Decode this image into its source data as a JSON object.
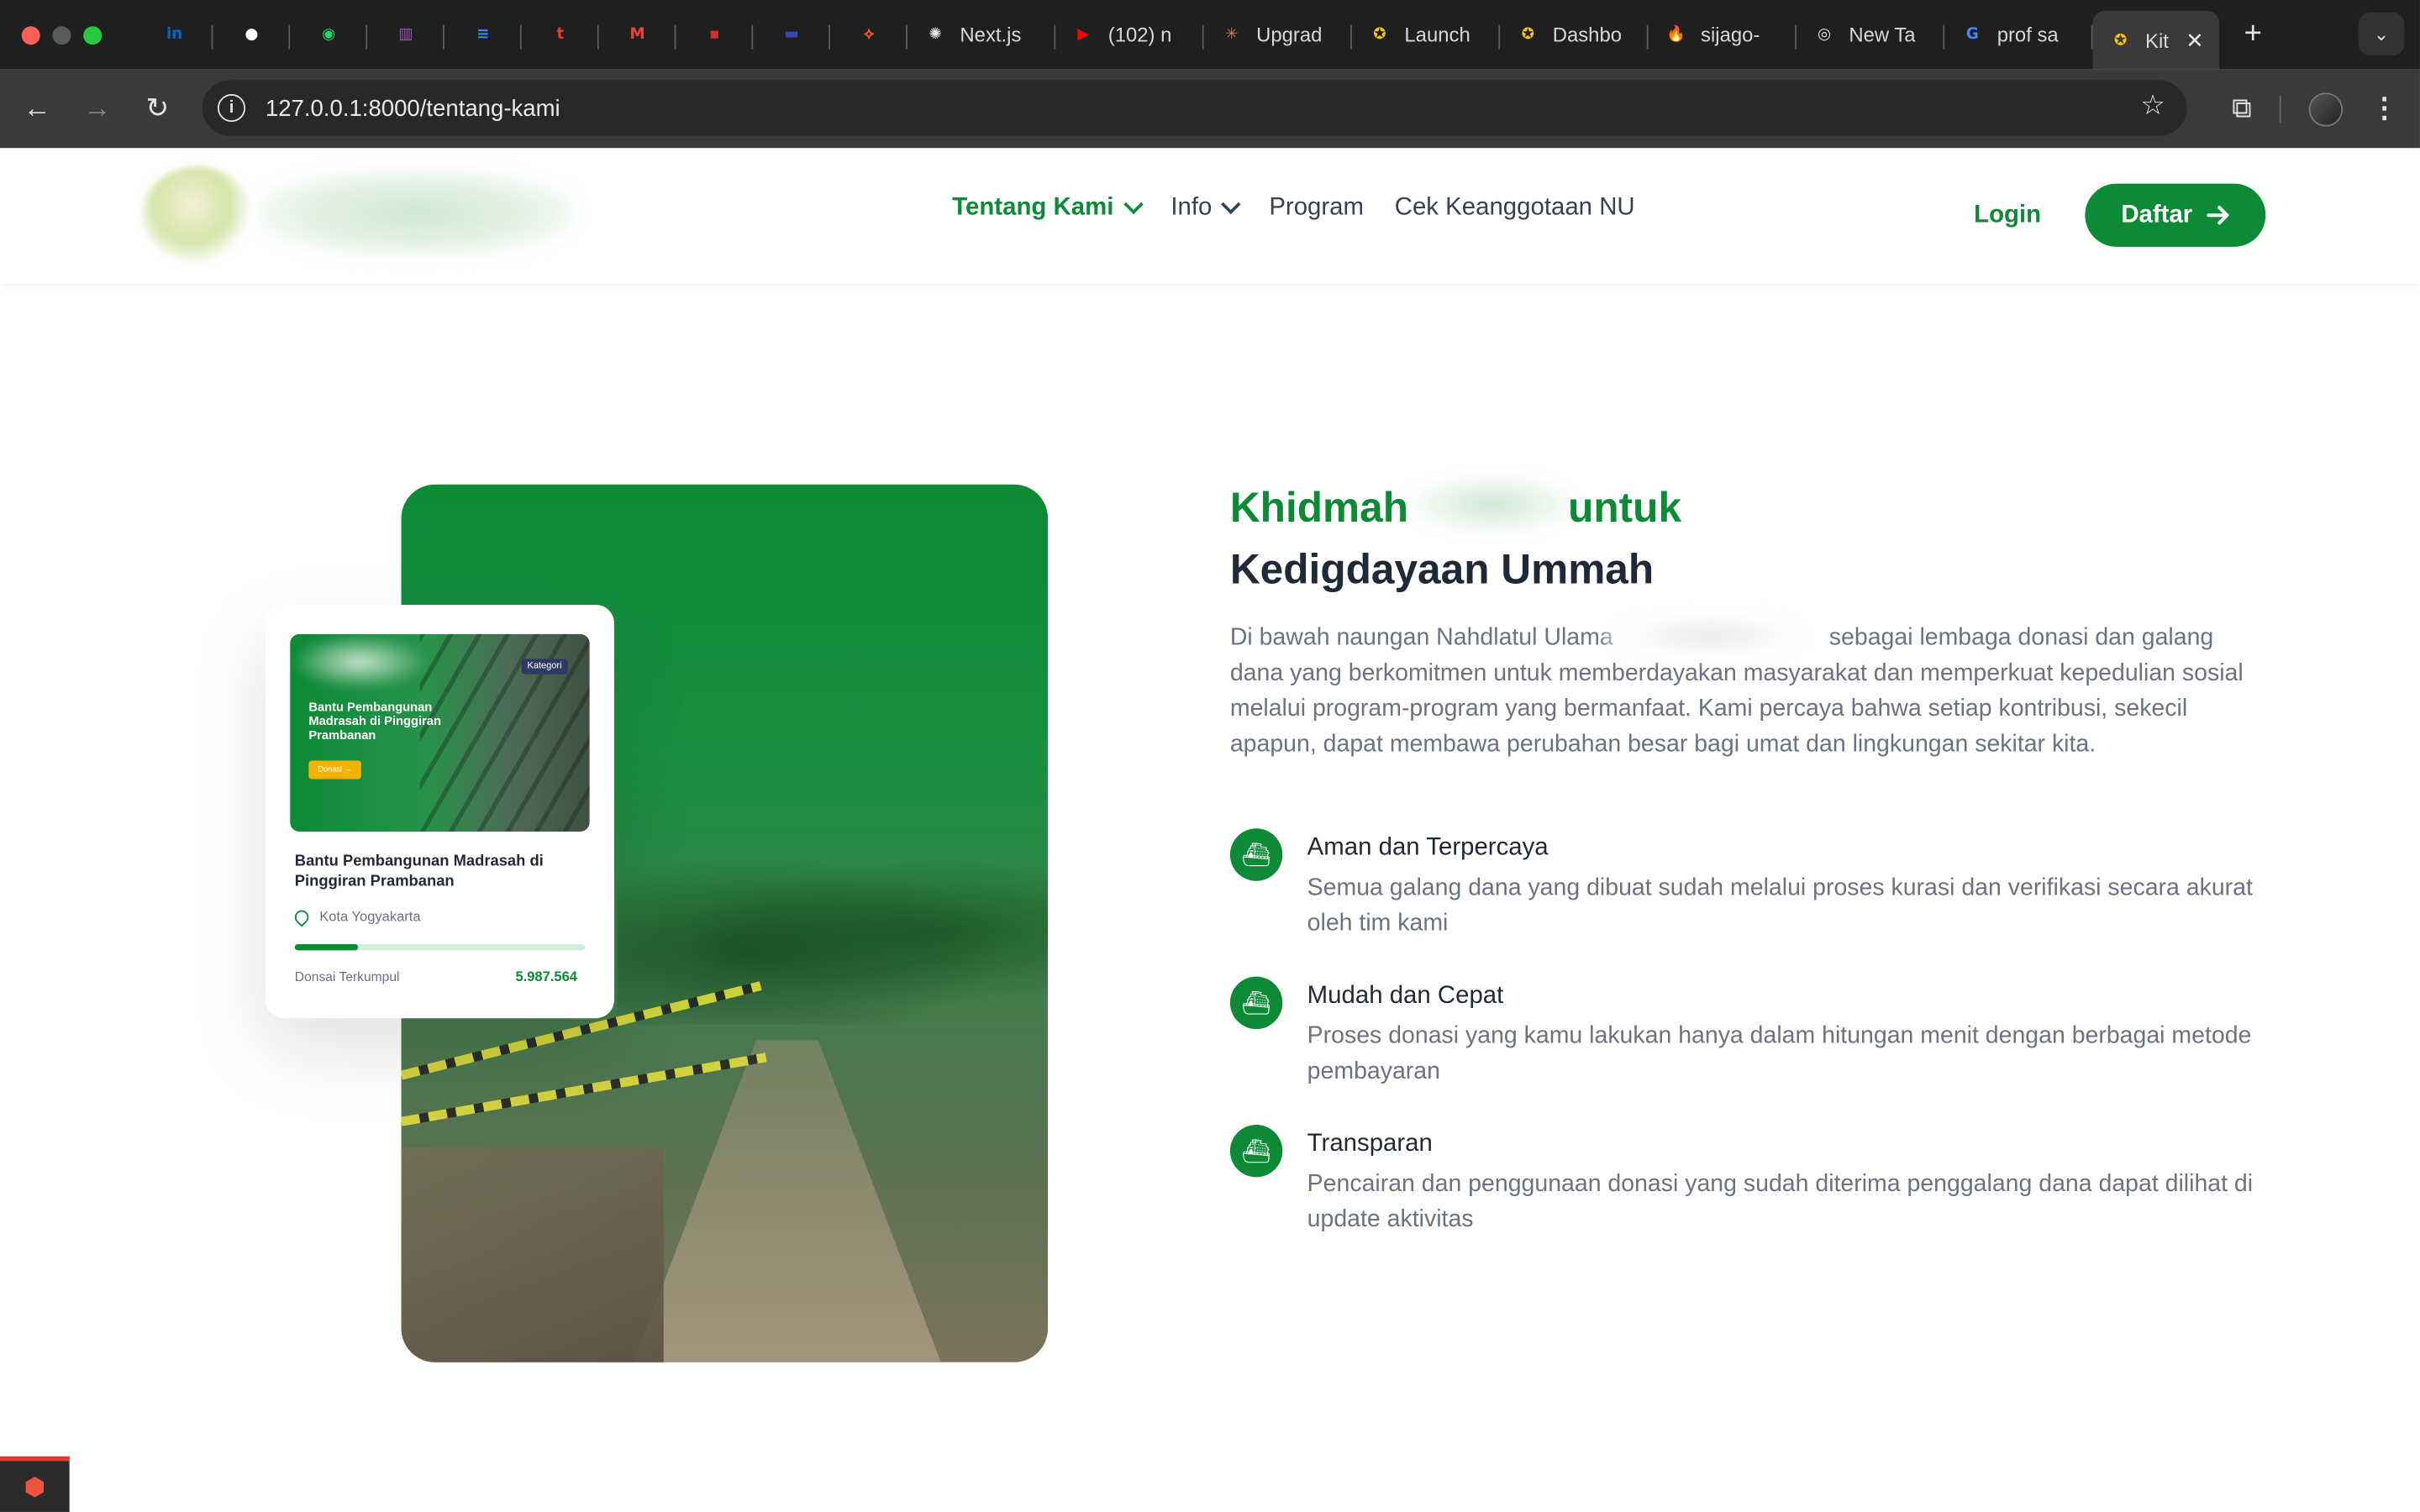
{
  "browser": {
    "tabs": [
      {
        "icon": "linkedin-icon",
        "glyph": "in",
        "color": "#0a66c2",
        "title": ""
      },
      {
        "icon": "github-icon",
        "glyph": "●",
        "color": "#ffffff",
        "title": ""
      },
      {
        "icon": "whatsapp-icon",
        "glyph": "◉",
        "color": "#25d366",
        "title": ""
      },
      {
        "icon": "trello-icon",
        "glyph": "▥",
        "color": "#9b59b6",
        "title": ""
      },
      {
        "icon": "docs-icon",
        "glyph": "≡",
        "color": "#4285f4",
        "title": ""
      },
      {
        "icon": "t-icon",
        "glyph": "t",
        "color": "#e53935",
        "title": ""
      },
      {
        "icon": "gmail-icon",
        "glyph": "M",
        "color": "#ea4335",
        "title": ""
      },
      {
        "icon": "toyota-icon",
        "glyph": "▪",
        "color": "#d32f2f",
        "title": ""
      },
      {
        "icon": "site-icon",
        "glyph": "▬",
        "color": "#3949ab",
        "title": ""
      },
      {
        "icon": "laravel-icon",
        "glyph": "⟡",
        "color": "#ff5722",
        "title": ""
      },
      {
        "icon": "openai-icon",
        "glyph": "✺",
        "color": "#e3e3e3",
        "title": "Next.js"
      },
      {
        "icon": "youtube-icon",
        "glyph": "▶",
        "color": "#ff0000",
        "title": "(102) n"
      },
      {
        "icon": "claude-icon",
        "glyph": "✳",
        "color": "#d97757",
        "title": "Upgrad"
      },
      {
        "icon": "nu-icon",
        "glyph": "✪",
        "color": "#f9c80e",
        "title": "Launch"
      },
      {
        "icon": "nu-icon",
        "glyph": "✪",
        "color": "#f9c80e",
        "title": "Dashbo"
      },
      {
        "icon": "firebase-icon",
        "glyph": "🔥",
        "color": "#ff9800",
        "title": "sijago-"
      },
      {
        "icon": "chrome-icon",
        "glyph": "◎",
        "color": "#e3e3e3",
        "title": "New Ta"
      },
      {
        "icon": "google-icon",
        "glyph": "G",
        "color": "#4285f4",
        "title": "prof sa"
      }
    ],
    "active_tab": {
      "icon": "nu-icon",
      "glyph": "✪",
      "color": "#f9c80e",
      "title": "Kit"
    },
    "url": "127.0.0.1:8000/tentang-kami"
  },
  "site": {
    "nav": [
      {
        "label": "Tentang Kami",
        "dropdown": true,
        "active": true
      },
      {
        "label": "Info",
        "dropdown": true,
        "active": false
      },
      {
        "label": "Program",
        "dropdown": false,
        "active": false
      },
      {
        "label": "Cek Keanggotaan NU",
        "dropdown": false,
        "active": false
      }
    ],
    "login": "Login",
    "register": "Daftar",
    "accent": "#0c8a36"
  },
  "card": {
    "badge": "Kategori",
    "image_title": "Bantu Pembangunan Madrasah di Pinggiran Prambanan",
    "image_button": "Donasi →",
    "title": "Bantu Pembangunan Madrasah di Pinggiran Prambanan",
    "location": "Kota Yogyakarta",
    "progress": 0.22,
    "collected_label": "Donsai Terkumpul",
    "collected_value": "5.987.564"
  },
  "about": {
    "heading_a": "Khidmah",
    "heading_b": "untuk",
    "heading_line2": "Kedigdayaan Ummah",
    "description_a": "Di bawah naungan Nahdlatul Ulama",
    "description_b": "sebagai lembaga donasi dan galang dana yang berkomitmen untuk memberdayakan masyarakat dan memperkuat kepedulian sosial melalui program-program yang bermanfaat. Kami percaya bahwa setiap kontribusi, sekecil apapun, dapat membawa perubahan besar bagi umat dan lingkungan sekitar kita.",
    "features": [
      {
        "title": "Aman dan Terpercaya",
        "text": "Semua galang dana yang dibuat sudah melalui proses kurasi dan verifikasi secara akurat oleh tim kami"
      },
      {
        "title": "Mudah dan Cepat",
        "text": "Proses donasi yang kamu lakukan hanya dalam hitungan menit dengan berbagai metode pembayaran"
      },
      {
        "title": "Transparan",
        "text": "Pencairan dan penggunaan donasi yang sudah diterima penggalang dana dapat dilihat di update aktivitas"
      }
    ]
  }
}
